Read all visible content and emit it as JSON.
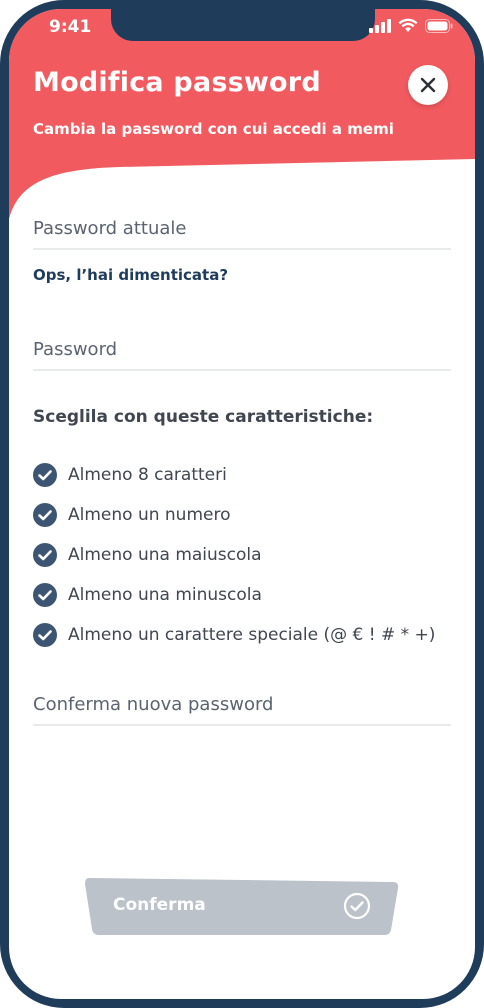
{
  "status_bar": {
    "time": "9:41",
    "signal_icon": "signal-icon",
    "wifi_icon": "wifi-icon",
    "battery_icon": "battery-icon"
  },
  "header": {
    "title": "Modifica password",
    "subtitle": "Cambia la password con cui accedi a memi",
    "close_icon": "close-icon",
    "background_color": "#f15a5e"
  },
  "form": {
    "current_password_label": "Password attuale",
    "forgot_link": "Ops, l’hai dimenticata?",
    "new_password_label": "Password",
    "requirements_title": "Sceglila con queste caratteristiche:",
    "requirements": [
      "Almeno 8 caratteri",
      "Almeno un numero",
      "Almeno una maiuscola",
      "Almeno una minuscola",
      "Almeno un carattere speciale (@ € ! # * +)"
    ],
    "confirm_password_label": "Conferma nuova password"
  },
  "confirm_button": {
    "label": "Conferma",
    "icon": "check-circle-icon",
    "disabled_color": "#bcc2ca"
  },
  "colors": {
    "frame": "#1f3c5b",
    "check": "#3c5573"
  }
}
